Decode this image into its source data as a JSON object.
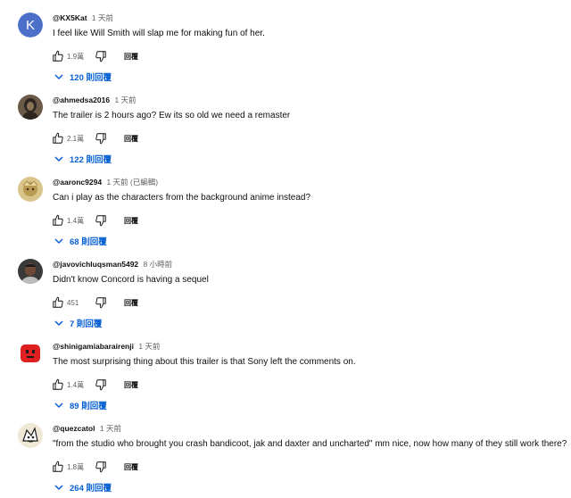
{
  "comments": [
    {
      "author": "@KX5Kat",
      "time": "1 天前",
      "text": "I feel like Will Smith will slap me for making fun of her.",
      "likes": "1.9萬",
      "reply_label": "回覆",
      "replies_label": "120 則回覆",
      "avatar": {
        "type": "letter",
        "letter": "K",
        "color": "#4c6fc9"
      }
    },
    {
      "author": "@ahmedsa2016",
      "time": "1 天前",
      "text": "The trailer is 2 hours ago? Ew its so old we need a remaster",
      "likes": "2.1萬",
      "reply_label": "回覆",
      "replies_label": "122 則回覆",
      "avatar": {
        "type": "image",
        "icon": "hooded-figure-avatar"
      }
    },
    {
      "author": "@aaronc9294",
      "time": "1 天前 (已編輯)",
      "text": "Can i play as the characters from the background anime instead?",
      "likes": "1.4萬",
      "reply_label": "回覆",
      "replies_label": "68 則回覆",
      "avatar": {
        "type": "image",
        "icon": "anime-character-avatar"
      }
    },
    {
      "author": "@javovichluqsman5492",
      "time": "8 小時前",
      "text": "Didn't know Concord is having a sequel",
      "likes": "451",
      "reply_label": "回覆",
      "replies_label": "7 則回覆",
      "avatar": {
        "type": "image",
        "icon": "portrait-avatar"
      }
    },
    {
      "author": "@shinigamiabarairenji",
      "time": "1 天前",
      "text": "The most surprising thing about this trailer is that Sony left the comments on.",
      "likes": "1.4萬",
      "reply_label": "回覆",
      "replies_label": "89 則回覆",
      "avatar": {
        "type": "image",
        "icon": "red-block-avatar"
      }
    },
    {
      "author": "@quezcatol",
      "time": "1 天前",
      "text": "\"from the studio who brought you crash bandicoot, jak and daxter and uncharted\" mm nice, now how many of they still work there?",
      "likes": "1.8萬",
      "reply_label": "回覆",
      "replies_label": "264 則回覆",
      "avatar": {
        "type": "image",
        "icon": "sketch-character-avatar"
      }
    }
  ],
  "colors": {
    "link": "#065fd4",
    "secondary_text": "#606060",
    "primary_text": "#0f0f0f"
  }
}
